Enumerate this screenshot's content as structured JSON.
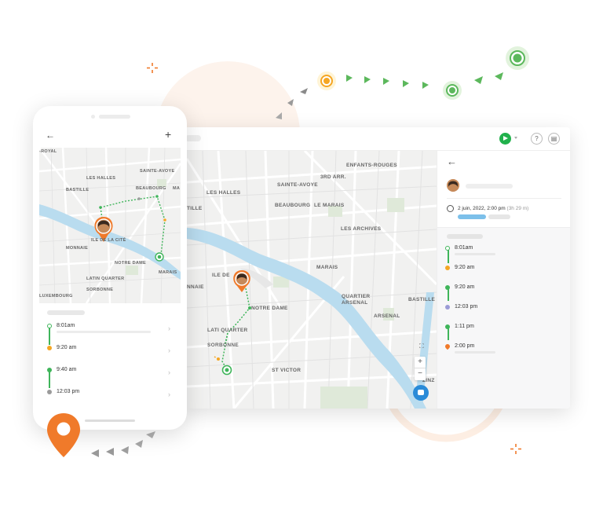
{
  "desktop": {
    "map_labels": {
      "les_halles": "LES HALLES",
      "sainte_avoye": "SAINTE-AVOYE",
      "3rd_arr": "3RD ARR.",
      "enfants_rouges": "ENFANTS-ROUGES",
      "beaubourg": "BEAUBOURG",
      "le_marais": "LE MARAIS",
      "tille": "TILLE",
      "les_archives": "LES ARCHIVES",
      "marais": "MARAIS",
      "ile_de": "ILE DE",
      "nnaie": "NNAIE",
      "notre_dame": "NOTRE DAME",
      "quartier_arsenal": "QUARTIER\nARSENAL",
      "quartier_line1": "QUARTIER",
      "quartier_line2": "ARSENAL",
      "bastille": "BASTILLE",
      "arsenal": "ARSENAL",
      "latin_quarter": "LATI  QUARTER",
      "sorbonne": "SORBONNE",
      "st_victor": "ST VICTOR",
      "zinz": "ZINZ"
    },
    "zoom_in": "+",
    "zoom_out": "−",
    "sidebar": {
      "back": "←",
      "date": "2 juin, 2022, 2:00 pm",
      "duration": "(3h 29 m)",
      "stops": [
        {
          "time": "8:01am",
          "color": "#3fb55a"
        },
        {
          "time": "9:20 am",
          "color": "#f5a623"
        },
        {
          "time": "9:20 am",
          "color": "#3fb55a"
        },
        {
          "time": "12:03 pm",
          "color": "#9b9bd6"
        },
        {
          "time": "1:11 pm",
          "color": "#3fb55a"
        },
        {
          "time": "2:00 pm",
          "color": "#f07a2a"
        }
      ]
    }
  },
  "phone": {
    "back": "←",
    "add": "+",
    "map_labels": {
      "royal": "-ROYAL",
      "les_halles": "LES HALLES",
      "sainte_avoye": "SAINTE-AVOYE",
      "bastille": "BASTILLE",
      "beaubourg": "BEAUBOURG",
      "ma": "MA",
      "ile_de_la_cite": "ILE DE LA CITÉ",
      "monnaie": "MONNAIE",
      "notre_dame": "NOTRE DAME",
      "marais": "MARAIS",
      "latin_quarter": "LATIN QUARTER",
      "sorbonne": "SORBONNE",
      "luxembourg": "LUXEMBOURG"
    },
    "stops": [
      {
        "time": "8:01am",
        "color": "#3fb55a"
      },
      {
        "time": "9:20 am",
        "color": "#f5a623"
      },
      {
        "time": "9:40 am",
        "color": "#3fb55a"
      },
      {
        "time": "12:03 pm",
        "color": "#9b9b9b"
      }
    ],
    "chevron": "›"
  },
  "colors": {
    "brand_orange": "#f07a2a",
    "green": "#3fb55a",
    "blue_pill": "#7cc0ea",
    "river": "#b9dcef"
  }
}
